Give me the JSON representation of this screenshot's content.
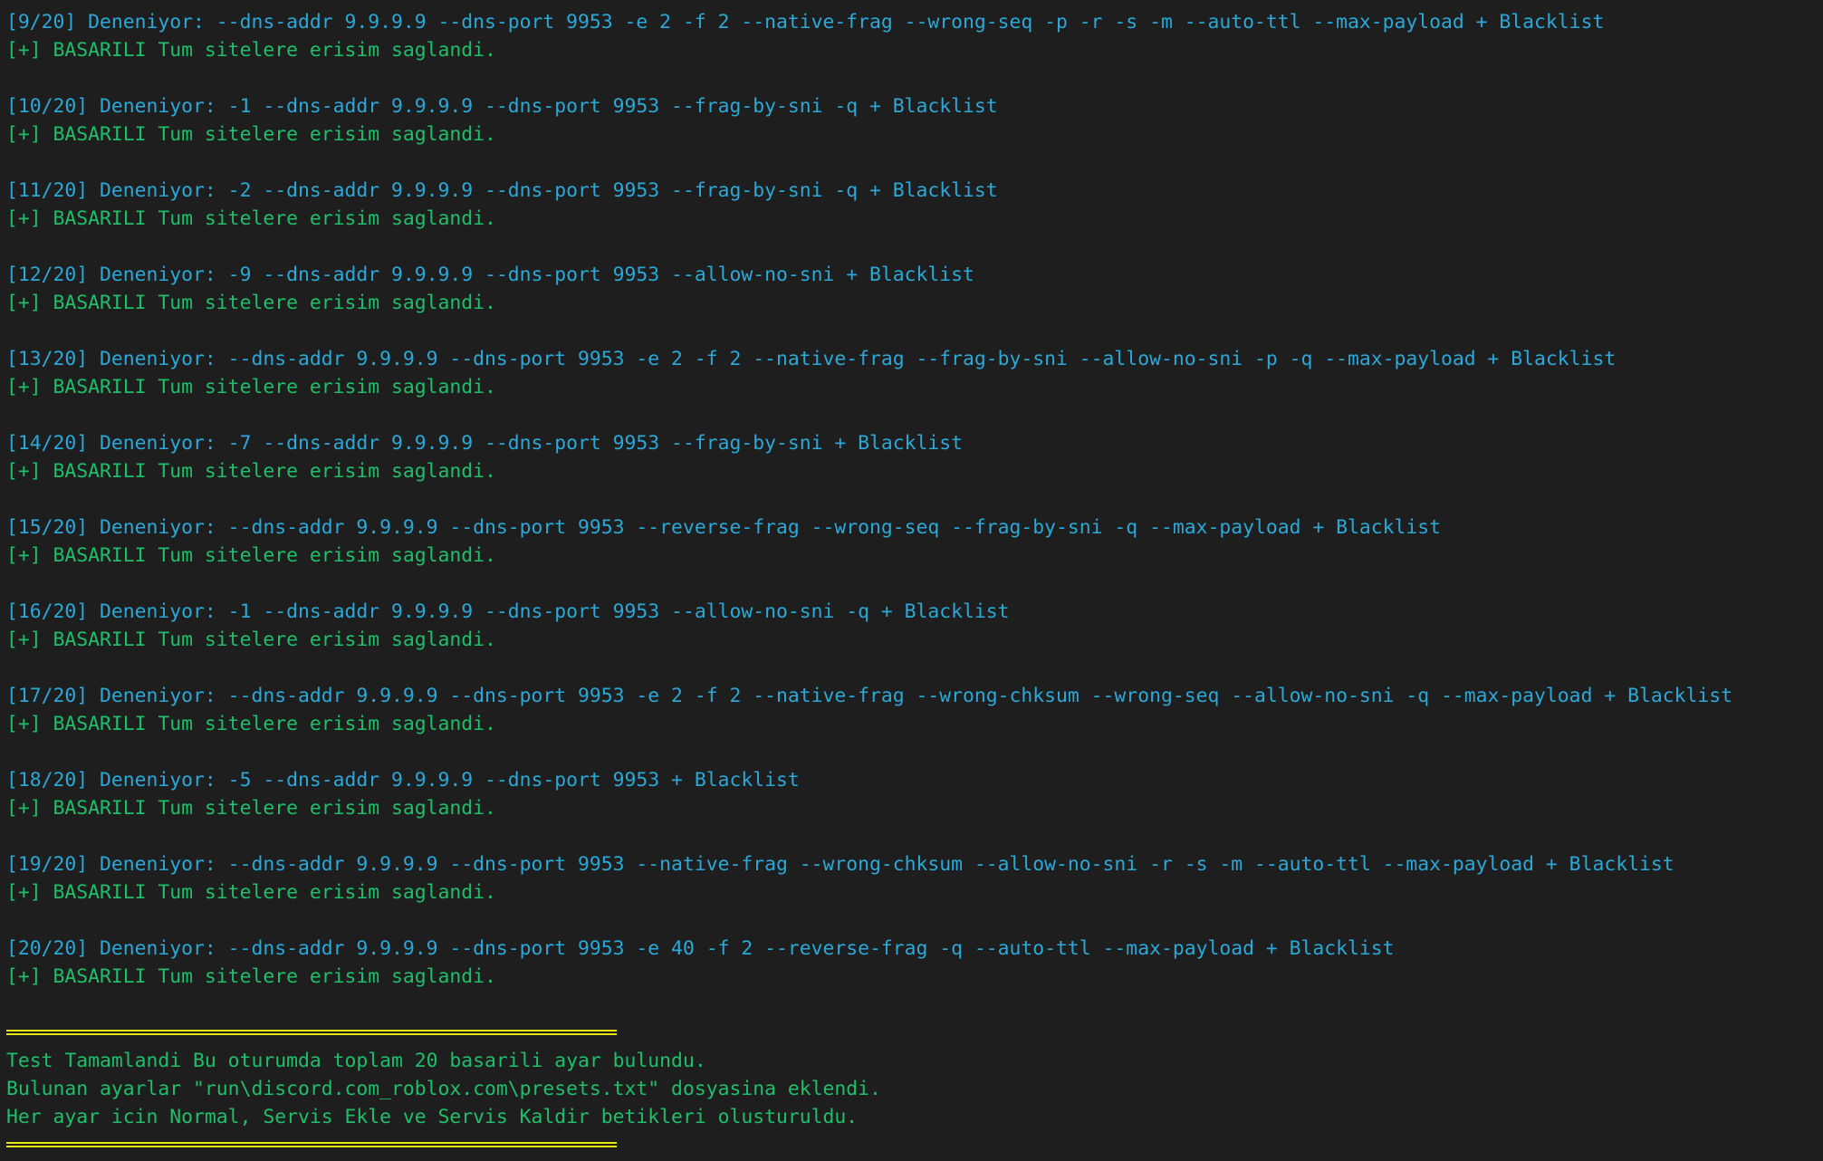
{
  "colors": {
    "background": "#1e1e1e",
    "command": "#2aa8d8",
    "success": "#1fbf6a",
    "separator": "#e5e510"
  },
  "attempts": [
    {
      "command": "[9/20] Deneniyor: --dns-addr 9.9.9.9 --dns-port 9953 -e 2 -f 2 --native-frag --wrong-seq -p -r -s -m --auto-ttl --max-payload + Blacklist",
      "result": "[+] BASARILI Tum sitelere erisim saglandi."
    },
    {
      "command": "[10/20] Deneniyor: -1 --dns-addr 9.9.9.9 --dns-port 9953 --frag-by-sni -q + Blacklist",
      "result": "[+] BASARILI Tum sitelere erisim saglandi."
    },
    {
      "command": "[11/20] Deneniyor: -2 --dns-addr 9.9.9.9 --dns-port 9953 --frag-by-sni -q + Blacklist",
      "result": "[+] BASARILI Tum sitelere erisim saglandi."
    },
    {
      "command": "[12/20] Deneniyor: -9 --dns-addr 9.9.9.9 --dns-port 9953 --allow-no-sni + Blacklist",
      "result": "[+] BASARILI Tum sitelere erisim saglandi."
    },
    {
      "command": "[13/20] Deneniyor: --dns-addr 9.9.9.9 --dns-port 9953 -e 2 -f 2 --native-frag --frag-by-sni --allow-no-sni -p -q --max-payload + Blacklist",
      "result": "[+] BASARILI Tum sitelere erisim saglandi."
    },
    {
      "command": "[14/20] Deneniyor: -7 --dns-addr 9.9.9.9 --dns-port 9953 --frag-by-sni + Blacklist",
      "result": "[+] BASARILI Tum sitelere erisim saglandi."
    },
    {
      "command": "[15/20] Deneniyor: --dns-addr 9.9.9.9 --dns-port 9953 --reverse-frag --wrong-seq --frag-by-sni -q --max-payload + Blacklist",
      "result": "[+] BASARILI Tum sitelere erisim saglandi."
    },
    {
      "command": "[16/20] Deneniyor: -1 --dns-addr 9.9.9.9 --dns-port 9953 --allow-no-sni -q + Blacklist",
      "result": "[+] BASARILI Tum sitelere erisim saglandi."
    },
    {
      "command": "[17/20] Deneniyor: --dns-addr 9.9.9.9 --dns-port 9953 -e 2 -f 2 --native-frag --wrong-chksum --wrong-seq --allow-no-sni -q --max-payload + Blacklist",
      "result": "[+] BASARILI Tum sitelere erisim saglandi."
    },
    {
      "command": "[18/20] Deneniyor: -5 --dns-addr 9.9.9.9 --dns-port 9953 + Blacklist",
      "result": "[+] BASARILI Tum sitelere erisim saglandi."
    },
    {
      "command": "[19/20] Deneniyor: --dns-addr 9.9.9.9 --dns-port 9953 --native-frag --wrong-chksum --allow-no-sni -r -s -m --auto-ttl --max-payload + Blacklist",
      "result": "[+] BASARILI Tum sitelere erisim saglandi."
    },
    {
      "command": "[20/20] Deneniyor: --dns-addr 9.9.9.9 --dns-port 9953 -e 40 -f 2 --reverse-frag -q --auto-ttl --max-payload + Blacklist",
      "result": "[+] BASARILI Tum sitelere erisim saglandi."
    }
  ],
  "summary": {
    "line1": "Test Tamamlandi Bu oturumda toplam 20 basarili ayar bulundu.",
    "line2": "Bulunan ayarlar \"run\\discord.com_roblox.com\\presets.txt\" dosyasina eklendi.",
    "line3": "Her ayar icin Normal, Servis Ekle ve Servis Kaldir betikleri olusturuldu."
  }
}
